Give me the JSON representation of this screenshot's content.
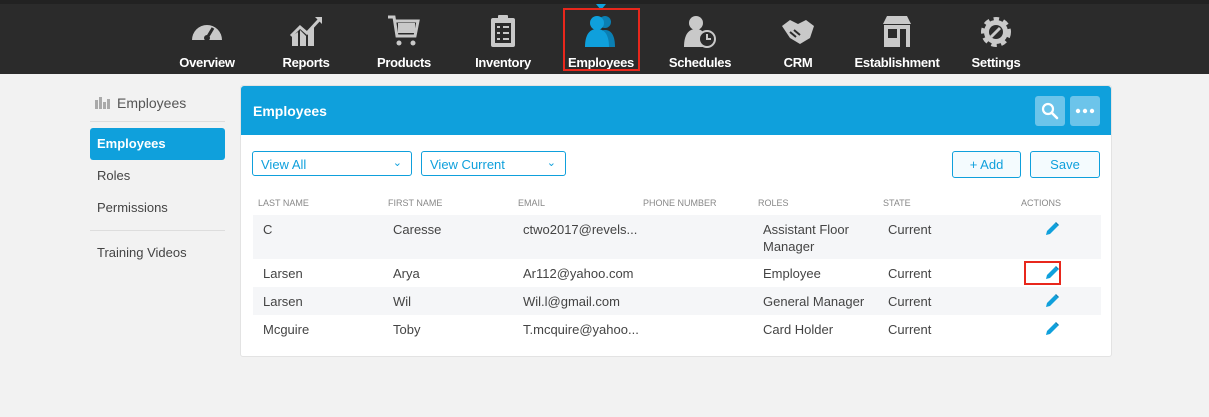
{
  "nav": {
    "items": [
      {
        "label": "Overview",
        "icon": "speedometer-icon"
      },
      {
        "label": "Reports",
        "icon": "chart-growth-icon"
      },
      {
        "label": "Products",
        "icon": "shopping-cart-icon"
      },
      {
        "label": "Inventory",
        "icon": "clipboard-checklist-icon"
      },
      {
        "label": "Employees",
        "icon": "users-icon",
        "active": true
      },
      {
        "label": "Schedules",
        "icon": "user-clock-icon"
      },
      {
        "label": "CRM",
        "icon": "handshake-icon"
      },
      {
        "label": "Establishment",
        "icon": "storefront-icon"
      },
      {
        "label": "Settings",
        "icon": "gear-wrench-icon"
      }
    ]
  },
  "sidebar": {
    "heading": "Employees",
    "items": [
      {
        "label": "Employees",
        "active": true
      },
      {
        "label": "Roles"
      },
      {
        "label": "Permissions"
      }
    ],
    "extra": [
      {
        "label": "Training Videos"
      }
    ]
  },
  "panel": {
    "title": "Employees",
    "filter1": "View All",
    "filter2": "View Current",
    "add_label": "+ Add",
    "save_label": "Save",
    "columns": [
      "LAST NAME",
      "FIRST NAME",
      "EMAIL",
      "PHONE NUMBER",
      "ROLES",
      "STATE",
      "ACTIONS"
    ],
    "rows": [
      {
        "last": "C",
        "first": "Caresse",
        "email": "ctwo2017@revels...",
        "phone": "",
        "role": "Assistant Floor Manager",
        "state": "Current"
      },
      {
        "last": "Larsen",
        "first": "Arya",
        "email": "Ar112@yahoo.com",
        "phone": "",
        "role": "Employee",
        "state": "Current"
      },
      {
        "last": "Larsen",
        "first": "Wil",
        "email": "Wil.l@gmail.com",
        "phone": "",
        "role": "General Manager",
        "state": "Current"
      },
      {
        "last": "Mcguire",
        "first": "Toby",
        "email": "T.mcquire@yahoo...",
        "phone": "",
        "role": "Card Holder",
        "state": "Current"
      }
    ]
  },
  "colors": {
    "accent": "#0fa0dc",
    "nav_bg": "#2b2b2b",
    "highlight": "#e8271c"
  }
}
